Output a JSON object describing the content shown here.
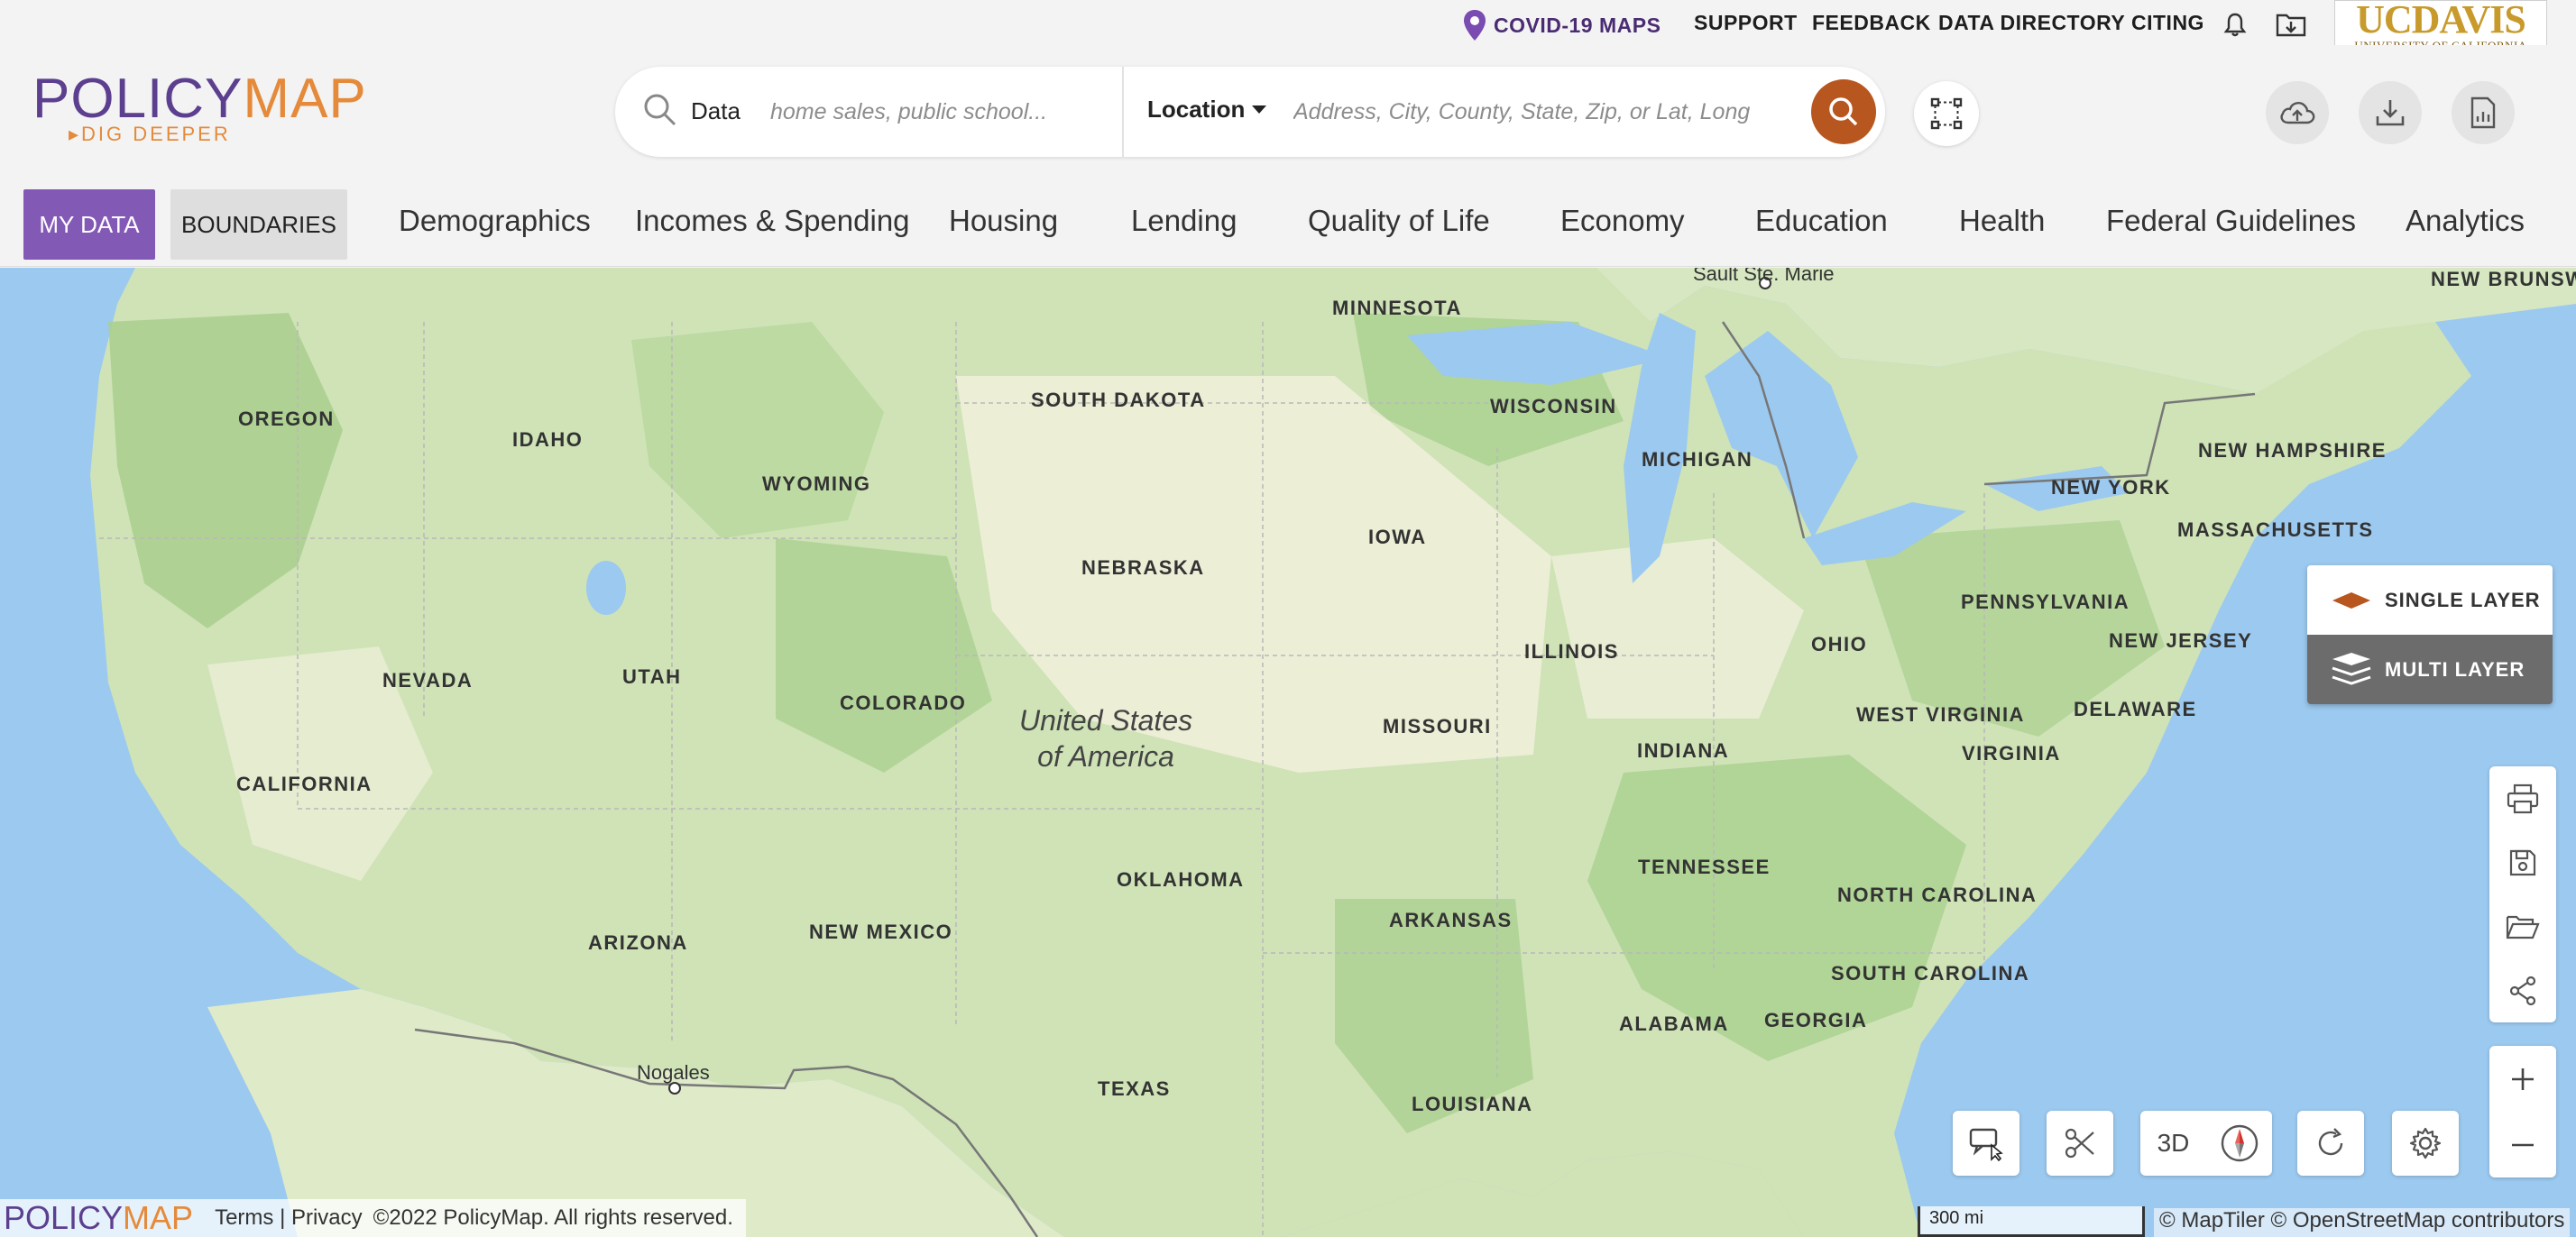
{
  "topbar": {
    "covid_link": "COVID-19 MAPS",
    "support": "SUPPORT",
    "feedback": "FEEDBACK",
    "data_directory": "DATA DIRECTORY",
    "citing": "CITING",
    "notification_icon": "bell-icon",
    "folder_icon": "folder-download-icon",
    "institution": {
      "name": "UCDAVIS",
      "subtitle": "UNIVERSITY OF CALIFORNIA"
    }
  },
  "header": {
    "logo": {
      "policy": "POLICY",
      "map": "MAP",
      "tagline": "DIG DEEPER"
    },
    "search": {
      "data_label": "Data",
      "data_placeholder": "home sales, public school...",
      "location_label": "Location",
      "location_placeholder": "Address, City, County, State, Zip, or Lat, Long"
    },
    "actions": [
      "upload-cloud-icon",
      "download-icon",
      "report-document-icon"
    ]
  },
  "nav": {
    "my_data": "MY DATA",
    "boundaries": "BOUNDARIES",
    "items": [
      "Demographics",
      "Incomes & Spending",
      "Housing",
      "Lending",
      "Quality of Life",
      "Economy",
      "Education",
      "Health",
      "Federal Guidelines",
      "Analytics"
    ]
  },
  "map": {
    "country_label": "United States of America",
    "country_line1": "United States",
    "country_line2": "of America",
    "state_labels": [
      "MINNESOTA",
      "SOUTH DAKOTA",
      "WISCONSIN",
      "MICHIGAN",
      "NEW HAMPSHIRE",
      "OREGON",
      "IDAHO",
      "WYOMING",
      "NEW YORK",
      "MASSACHUSETTS",
      "IOWA",
      "NEBRASKA",
      "PENNSYLVANIA",
      "NEW JERSEY",
      "NEVADA",
      "UTAH",
      "ILLINOIS",
      "OHIO",
      "COLORADO",
      "WEST VIRGINIA",
      "DELAWARE",
      "MISSOURI",
      "INDIANA",
      "VIRGINIA",
      "CALIFORNIA",
      "TENNESSEE",
      "OKLAHOMA",
      "NORTH CAROLINA",
      "ARKANSAS",
      "ARIZONA",
      "NEW MEXICO",
      "SOUTH CAROLINA",
      "ALABAMA",
      "GEORGIA",
      "TEXAS",
      "LOUISIANA",
      "NEW BRUNSWI"
    ],
    "city_labels": [
      "Sault Ste. Marie",
      "Nogales"
    ],
    "layer_single": "SINGLE LAYER",
    "layer_multi": "MULTI LAYER",
    "btn_3d": "3D",
    "scale": "300 mi",
    "attribution": "© MapTiler © OpenStreetMap contributors"
  },
  "footer": {
    "logo_policy": "POLICY",
    "logo_map": "MAP",
    "links": "Terms | Privacy",
    "copyright": "©2022 PolicyMap. All rights reserved."
  },
  "colors": {
    "brand_purple": "#5c3f8f",
    "brand_orange": "#e48a3a",
    "my_data_bg": "#8359b6",
    "search_button": "#b8561f",
    "water": "#9cc9ef",
    "land": "#cfe3b7",
    "ucdavis_gold": "#c89a2b"
  }
}
